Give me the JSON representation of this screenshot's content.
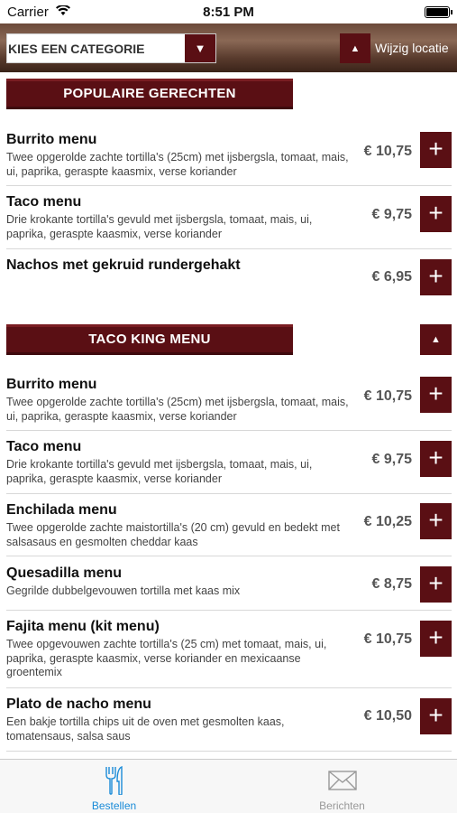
{
  "status_bar": {
    "carrier": "Carrier",
    "time": "8:51 PM"
  },
  "top_bar": {
    "category_placeholder": "KIES EEN CATEGORIE",
    "location_label": "Wijzig locatie"
  },
  "sections": [
    {
      "title": "POPULAIRE GERECHTEN",
      "items": [
        {
          "name": "Burrito menu",
          "desc": "Twee opgerolde zachte tortilla's (25cm) met ijsbergsla, tomaat, mais, ui, paprika, geraspte kaasmix, verse koriander",
          "price": "€ 10,75"
        },
        {
          "name": "Taco menu",
          "desc": "Drie krokante tortilla's gevuld met ijsbergsla, tomaat, mais, ui, paprika, geraspte kaasmix, verse koriander",
          "price": "€ 9,75"
        },
        {
          "name": "Nachos met gekruid rundergehakt",
          "desc": "",
          "price": "€ 6,95"
        }
      ]
    },
    {
      "title": "TACO KING MENU",
      "items": [
        {
          "name": "Burrito menu",
          "desc": "Twee opgerolde zachte tortilla's (25cm) met ijsbergsla, tomaat, mais, ui, paprika, geraspte kaasmix, verse koriander",
          "price": "€ 10,75"
        },
        {
          "name": "Taco menu",
          "desc": "Drie krokante tortilla's gevuld met ijsbergsla, tomaat, mais, ui, paprika, geraspte kaasmix, verse koriander",
          "price": "€ 9,75"
        },
        {
          "name": "Enchilada menu",
          "desc": "Twee opgerolde zachte maistortilla's (20 cm) gevuld en bedekt met salsasaus en gesmolten cheddar kaas",
          "price": "€ 10,25"
        },
        {
          "name": "Quesadilla menu",
          "desc": "Gegrilde dubbelgevouwen tortilla met kaas mix",
          "price": "€ 8,75"
        },
        {
          "name": "Fajita menu (kit menu)",
          "desc": "Twee opgevouwen zachte tortilla's (25 cm) met tomaat, mais, ui, paprika, geraspte kaasmix, verse koriander en mexicaanse groentemix",
          "price": "€ 10,75"
        },
        {
          "name": "Plato de nacho menu",
          "desc": "Een bakje tortilla chips uit de oven met gesmolten kaas, tomatensaus, salsa saus",
          "price": "€ 10,50"
        }
      ]
    }
  ],
  "tabs": [
    {
      "label": "Bestellen",
      "icon": "fork-knife-icon",
      "active": true
    },
    {
      "label": "Berichten",
      "icon": "envelope-icon",
      "active": false
    }
  ],
  "colors": {
    "accent": "#5a0f14",
    "tab_active": "#1a8bd8"
  }
}
